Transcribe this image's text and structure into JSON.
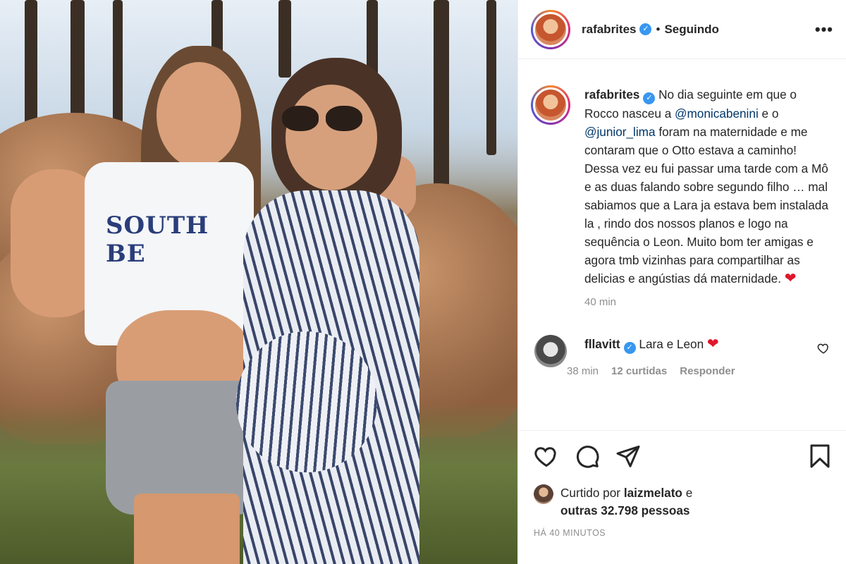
{
  "post": {
    "username": "rafabrites",
    "follow_status": "Seguindo",
    "separator": "•",
    "more_label": "•••",
    "photo_shirt_text": "SOUTH BE"
  },
  "caption": {
    "username": "rafabrites",
    "text_1": " No dia seguinte em que o Rocco nasceu a ",
    "mention_1": "@monicabenini",
    "text_2": " e o ",
    "mention_2": "@junior_lima",
    "text_3": " foram na maternidade e me contaram que o Otto estava a caminho! Dessa vez eu fui passar uma tarde com a Mô e as duas falando sobre segundo filho … mal sabiamos que a Lara ja estava bem instalada la , rindo dos nossos planos e logo na sequência o Leon. Muito bom ter amigas e agora tmb vizinhas para compartilhar as delicias e angústias dá maternidade. ",
    "emoji": "❤",
    "time": "40 min"
  },
  "comment": {
    "username": "fllavitt",
    "text": " Lara e Leon ",
    "emoji": "❤",
    "time": "38 min",
    "likes": "12 curtidas",
    "reply": "Responder"
  },
  "likes": {
    "prefix": "Curtido por ",
    "user": "laizmelato",
    "conj": " e",
    "others": "outras 32.798 pessoas"
  },
  "posted_ago": "HÁ 40 MINUTOS",
  "colors": {
    "verified": "#3897f0",
    "mention": "#00376b",
    "heart": "#e0162b",
    "muted": "#8e8e8e"
  }
}
